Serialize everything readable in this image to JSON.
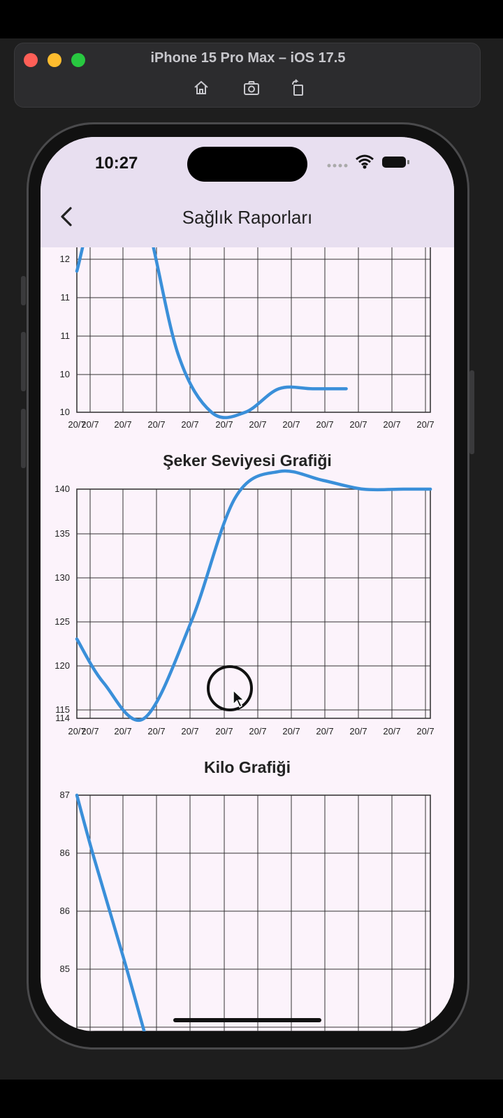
{
  "simulator": {
    "title": "iPhone 15 Pro Max – iOS 17.5",
    "toolbar_icons": [
      "home-icon",
      "screenshot-icon",
      "rotate-icon"
    ]
  },
  "status_bar": {
    "time": "10:27"
  },
  "nav": {
    "title": "Sağlık Raporları",
    "back_icon": "chevron-left-icon"
  },
  "charts": [
    {
      "title": ""
    },
    {
      "title": "Şeker Seviyesi Grafiği"
    },
    {
      "title": "Kilo Grafiği"
    }
  ],
  "colors": {
    "line": "#3a8fd9",
    "nav_bg": "#e8dff0",
    "page_bg": "#fcf3fb"
  },
  "chart_data": [
    {
      "type": "line",
      "title": "",
      "categories": [
        "20/7",
        "20/7",
        "20/7",
        "20/7",
        "20/7",
        "20/7",
        "20/7",
        "20/7",
        "20/7",
        "20/7",
        "20/7",
        "20/7"
      ],
      "y_tick_labels": [
        "10",
        "10",
        "11",
        "11",
        "12"
      ],
      "x": [
        0,
        1,
        2,
        3,
        4,
        5,
        6,
        7,
        8
      ],
      "values": [
        12.0,
        14.0,
        13.0,
        10.6,
        9.6,
        9.6,
        10.0,
        10.0,
        10.0
      ],
      "ylim": [
        9.6,
        12.5
      ],
      "grid": true
    },
    {
      "type": "line",
      "title": "Şeker Seviyesi Grafiği",
      "categories": [
        "20/7",
        "20/7",
        "20/7",
        "20/7",
        "20/7",
        "20/7",
        "20/7",
        "20/7",
        "20/7",
        "20/7",
        "20/7",
        "20/7"
      ],
      "y_tick_labels": [
        "114",
        "115",
        "120",
        "125",
        "130",
        "135",
        "140"
      ],
      "x": [
        0,
        0.8,
        2,
        3.4,
        4.7,
        6,
        7.3,
        8.5,
        9.7,
        10.5
      ],
      "values": [
        123,
        118,
        114,
        125,
        139,
        142,
        141,
        140,
        140,
        140
      ],
      "ylim": [
        114,
        140
      ],
      "grid": true
    },
    {
      "type": "line",
      "title": "Kilo Grafiği",
      "categories": [],
      "y_tick_labels": [
        "87",
        "86",
        "86",
        "85"
      ],
      "x": [
        0,
        0.5,
        1.4,
        2.0
      ],
      "values": [
        87,
        86.4,
        85.4,
        84.7
      ],
      "ylim": [
        84.7,
        87
      ],
      "grid": true
    }
  ]
}
